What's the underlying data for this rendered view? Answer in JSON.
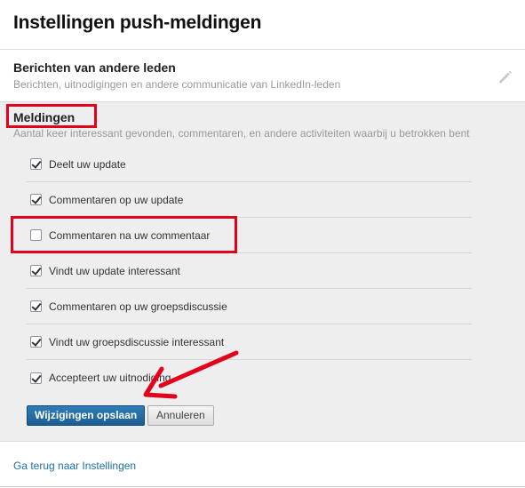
{
  "page": {
    "title": "Instellingen push-meldingen"
  },
  "members_section": {
    "title": "Berichten van andere leden",
    "description": "Berichten, uitnodigingen en andere communicatie van LinkedIn-leden",
    "edit_icon": "pencil-icon"
  },
  "notifications_section": {
    "title": "Meldingen",
    "description": "Aantal keer interessant gevonden, commentaren, en andere activiteiten waarbij u betrokken bent",
    "options": [
      {
        "label": "Deelt uw update",
        "checked": true
      },
      {
        "label": "Commentaren op uw update",
        "checked": true
      },
      {
        "label": "Commentaren na uw commentaar",
        "checked": false
      },
      {
        "label": "Vindt uw update interessant",
        "checked": true
      },
      {
        "label": "Commentaren op uw groepsdiscussie",
        "checked": true
      },
      {
        "label": "Vindt uw groepsdiscussie interessant",
        "checked": true
      },
      {
        "label": "Accepteert uw uitnodiging",
        "checked": true
      }
    ],
    "save_label": "Wijzigingen opslaan",
    "cancel_label": "Annuleren"
  },
  "footer": {
    "back_link": "Ga terug naar Instellingen"
  },
  "colors": {
    "highlight": "#e3001b",
    "primary_button": "#1b5d91",
    "link": "#1e6ea6",
    "section_background": "#eeeeee"
  }
}
